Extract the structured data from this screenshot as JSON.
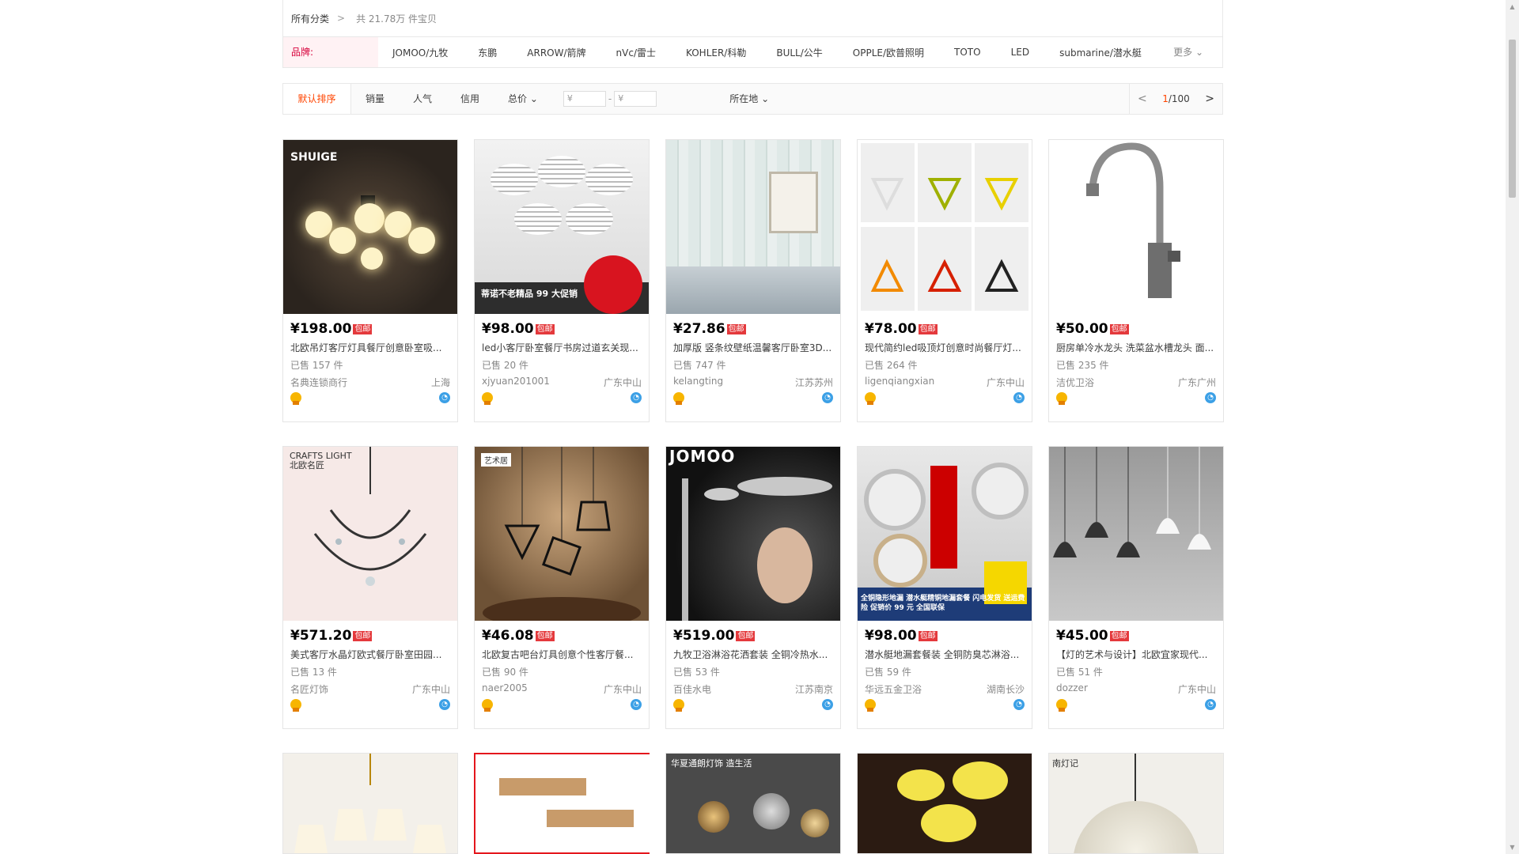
{
  "breadcrumb": {
    "all": "所有分类",
    "chevron": ">",
    "total": "共 21.78万 件宝贝"
  },
  "brand_filter": {
    "label": "品牌:",
    "brands": [
      "JOMOO/九牧",
      "东鹏",
      "ARROW/箭牌",
      "nVc/雷士",
      "KOHLER/科勒",
      "BULL/公牛",
      "OPPLE/欧普照明",
      "TOTO",
      "LED",
      "submarine/潜水艇"
    ],
    "more": "更多 ⌄"
  },
  "sort_bar": {
    "tabs": [
      "默认排序",
      "销量",
      "人气",
      "信用",
      "总价 ⌄"
    ],
    "price_from_placeholder": "¥",
    "price_to_placeholder": "¥",
    "price_dash": "-",
    "location": "所在地 ⌄",
    "pager_current": "1",
    "pager_total": "/100",
    "prev": "<",
    "next": ">"
  },
  "products": [
    {
      "price": "¥198.00",
      "tag": "包邮",
      "title": "北欧吊灯客厅灯具餐厅创意卧室吸...",
      "sold": "已售 157 件",
      "shop": "名典连锁商行",
      "location": "上海",
      "image_label": "SHUIGE"
    },
    {
      "price": "¥98.00",
      "tag": "包邮",
      "title": "led小客厅卧室餐厅书房过道玄关现...",
      "sold": "已售 20 件",
      "shop": "xjyuan201001",
      "location": "广东中山",
      "image_label": "蒂诺不老精品 99 大促销"
    },
    {
      "price": "¥27.86",
      "tag": "包邮",
      "title": "加厚版 竖条纹壁纸温馨客厅卧室3D...",
      "sold": "已售 747 件",
      "shop": "kelangting",
      "location": "江苏苏州",
      "image_label": ""
    },
    {
      "price": "¥78.00",
      "tag": "包邮",
      "title": "现代简约led吸顶灯创意时尚餐厅灯...",
      "sold": "已售 264 件",
      "shop": "ligenqiangxian",
      "location": "广东中山",
      "image_label": ""
    },
    {
      "price": "¥50.00",
      "tag": "包邮",
      "title": "厨房单冷水龙头 洗菜盆水槽龙头 面...",
      "sold": "已售 235 件",
      "shop": "洁优卫浴",
      "location": "广东广州",
      "image_label": ""
    },
    {
      "price": "¥571.20",
      "tag": "包邮",
      "title": "美式客厅水晶灯欧式餐厅卧室田园...",
      "sold": "已售 13 件",
      "shop": "名匠灯饰",
      "location": "广东中山",
      "image_label": "CRAFTS LIGHT 北欧名匠"
    },
    {
      "price": "¥46.08",
      "tag": "包邮",
      "title": "北欧复古吧台灯具创意个性客厅餐...",
      "sold": "已售 90 件",
      "shop": "naer2005",
      "location": "广东中山",
      "image_label": "艺术居"
    },
    {
      "price": "¥519.00",
      "tag": "包邮",
      "title": "九牧卫浴淋浴花洒套装 全铜冷热水...",
      "sold": "已售 53 件",
      "shop": "百佳水电",
      "location": "江苏南京",
      "image_label": "JOMOO"
    },
    {
      "price": "¥98.00",
      "tag": "包邮",
      "title": "潜水艇地漏套餐装 全铜防臭芯淋浴...",
      "sold": "已售 59 件",
      "shop": "华远五金卫浴",
      "location": "湖南长沙",
      "image_label": "全铜隐形地漏 潜水艇精铜地漏套餐 闪电发货 送运费险 促销价 99 元 全国联保"
    },
    {
      "price": "¥45.00",
      "tag": "包邮",
      "title": "【灯的艺术与设计】北欧宜家现代...",
      "sold": "已售 51 件",
      "shop": "dozzer",
      "location": "广东中山",
      "image_label": ""
    },
    {
      "price": "",
      "tag": "",
      "title": "",
      "sold": "",
      "shop": "",
      "location": "",
      "image_label": ""
    },
    {
      "price": "",
      "tag": "",
      "title": "",
      "sold": "",
      "shop": "",
      "location": "",
      "image_label": ""
    },
    {
      "price": "",
      "tag": "",
      "title": "",
      "sold": "",
      "shop": "",
      "location": "",
      "image_label": "华夏通朗灯饰 造生活"
    },
    {
      "price": "",
      "tag": "",
      "title": "",
      "sold": "",
      "shop": "",
      "location": "",
      "image_label": ""
    },
    {
      "price": "",
      "tag": "",
      "title": "",
      "sold": "",
      "shop": "",
      "location": "",
      "image_label": "南灯记"
    }
  ],
  "colors": {
    "accent": "#ff4400",
    "brand_label": "#d7003a",
    "free_shipping_tag": "#e4393c",
    "selected_border": "#e4161c"
  }
}
